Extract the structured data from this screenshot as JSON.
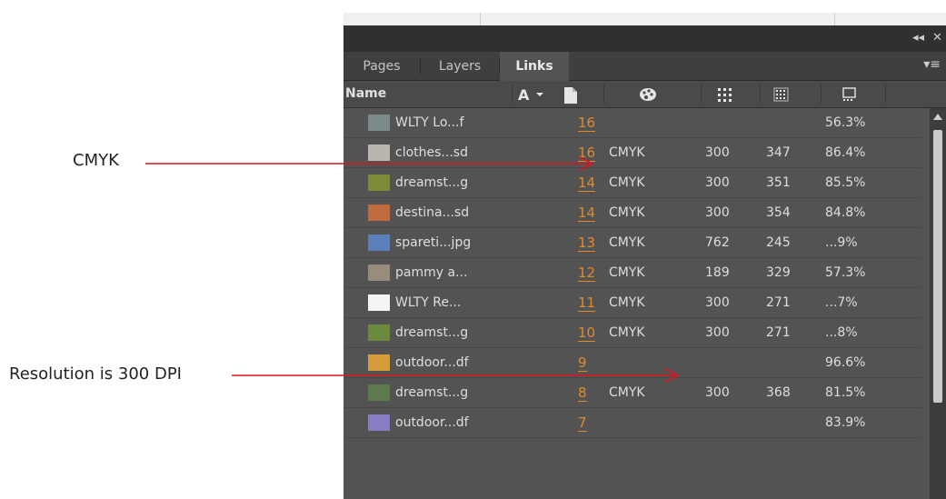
{
  "annotations": [
    {
      "text": "CMYK"
    },
    {
      "text": "Resolution is 300 DPI"
    }
  ],
  "titlebar": {
    "collapse_label": "◂◂",
    "close_label": "✕"
  },
  "tabs": [
    {
      "label": "Pages",
      "active": false
    },
    {
      "label": "Layers",
      "active": false
    },
    {
      "label": "Links",
      "active": true
    }
  ],
  "panel_menu_label": "▾≡",
  "header": {
    "name_label": "Name",
    "icons": [
      "status-warning-icon",
      "page-icon",
      "color-space-icon",
      "actual-ppi-icon",
      "effective-ppi-icon",
      "scale-icon"
    ]
  },
  "links": [
    {
      "name": "WLTY Lo...f",
      "page": "16",
      "color_space": "",
      "actual_ppi": "",
      "effective_ppi": "",
      "scale": "56.3%",
      "thumb": "#7d8a8a"
    },
    {
      "name": "clothes...sd",
      "page": "16",
      "color_space": "CMYK",
      "actual_ppi": "300",
      "effective_ppi": "347",
      "scale": "86.4%",
      "thumb": "#b9b6ae"
    },
    {
      "name": "dreamst...g",
      "page": "14",
      "color_space": "CMYK",
      "actual_ppi": "300",
      "effective_ppi": "351",
      "scale": "85.5%",
      "thumb": "#7d8b3a"
    },
    {
      "name": "destina...sd",
      "page": "14",
      "color_space": "CMYK",
      "actual_ppi": "300",
      "effective_ppi": "354",
      "scale": "84.8%",
      "thumb": "#c06a3e"
    },
    {
      "name": "spareti...jpg",
      "page": "13",
      "color_space": "CMYK",
      "actual_ppi": "762",
      "effective_ppi": "245",
      "scale": "...9%",
      "thumb": "#5b7fb8"
    },
    {
      "name": "pammy a...",
      "page": "12",
      "color_space": "CMYK",
      "actual_ppi": "189",
      "effective_ppi": "329",
      "scale": "57.3%",
      "thumb": "#9a8c7c"
    },
    {
      "name": "WLTY Re...",
      "page": "11",
      "color_space": "CMYK",
      "actual_ppi": "300",
      "effective_ppi": "271",
      "scale": "...7%",
      "thumb": "#f5f5f5"
    },
    {
      "name": "dreamst...g",
      "page": "10",
      "color_space": "CMYK",
      "actual_ppi": "300",
      "effective_ppi": "271",
      "scale": "...8%",
      "thumb": "#6b8a3e"
    },
    {
      "name": "outdoor...df",
      "page": "9",
      "color_space": "",
      "actual_ppi": "",
      "effective_ppi": "",
      "scale": "96.6%",
      "thumb": "#d69b3a"
    },
    {
      "name": "dreamst...g",
      "page": "8",
      "color_space": "CMYK",
      "actual_ppi": "300",
      "effective_ppi": "368",
      "scale": "81.5%",
      "thumb": "#5c7a4a"
    },
    {
      "name": "outdoor...df",
      "page": "7",
      "color_space": "",
      "actual_ppi": "",
      "effective_ppi": "",
      "scale": "83.9%",
      "thumb": "#8a7cc2"
    }
  ],
  "colors": {
    "annotation_arrow": "#d9151b",
    "page_number": "#e08a2c",
    "panel_bg": "#535353"
  }
}
